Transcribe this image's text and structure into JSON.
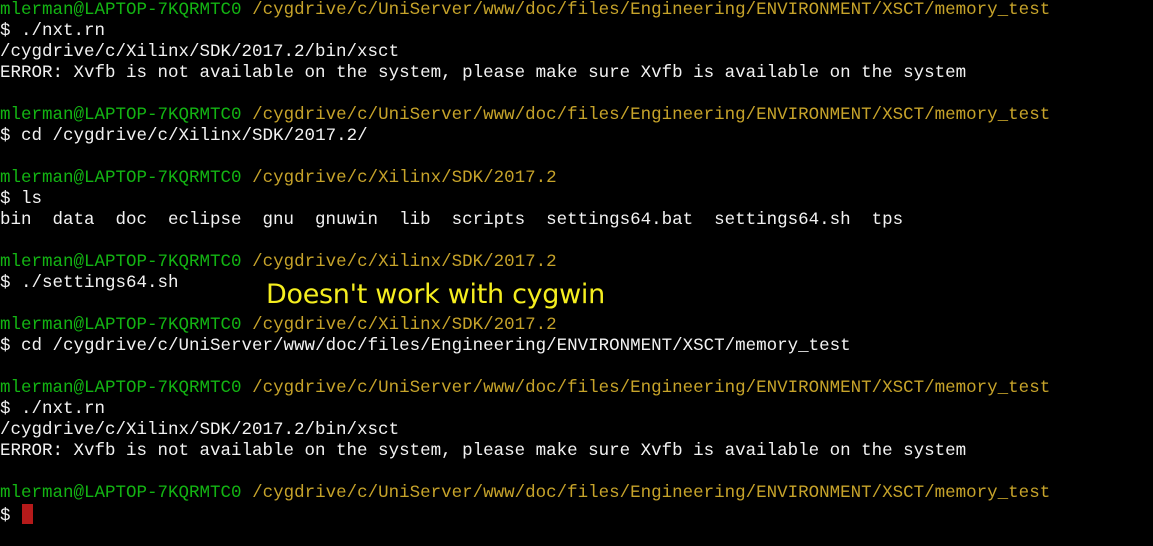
{
  "colors": {
    "background": "#000000",
    "user_host": "#13b413",
    "path": "#c6a32a",
    "text": "#f2f2f2",
    "annotation": "#f5ee1f",
    "cursor": "#b51a1a"
  },
  "prompt": {
    "user_host": "mlerman@LAPTOP-7KQRMTC0",
    "symbol": "$ "
  },
  "blocks": [
    {
      "path": "/cygdrive/c/UniServer/www/doc/files/Engineering/ENVIRONMENT/XSCT/memory_test",
      "command": "./nxt.rn",
      "output": [
        "/cygdrive/c/Xilinx/SDK/2017.2/bin/xsct",
        "ERROR: Xvfb is not available on the system, please make sure Xvfb is available on the system"
      ]
    },
    {
      "path": "/cygdrive/c/UniServer/www/doc/files/Engineering/ENVIRONMENT/XSCT/memory_test",
      "command": "cd /cygdrive/c/Xilinx/SDK/2017.2/",
      "output": []
    },
    {
      "path": "/cygdrive/c/Xilinx/SDK/2017.2",
      "command": "ls",
      "output": [
        "bin  data  doc  eclipse  gnu  gnuwin  lib  scripts  settings64.bat  settings64.sh  tps"
      ]
    },
    {
      "path": "/cygdrive/c/Xilinx/SDK/2017.2",
      "command": "./settings64.sh",
      "output": []
    },
    {
      "path": "/cygdrive/c/Xilinx/SDK/2017.2",
      "command": "cd /cygdrive/c/UniServer/www/doc/files/Engineering/ENVIRONMENT/XSCT/memory_test",
      "output": []
    },
    {
      "path": "/cygdrive/c/UniServer/www/doc/files/Engineering/ENVIRONMENT/XSCT/memory_test",
      "command": "./nxt.rn",
      "output": [
        "/cygdrive/c/Xilinx/SDK/2017.2/bin/xsct",
        "ERROR: Xvfb is not available on the system, please make sure Xvfb is available on the system"
      ]
    },
    {
      "path": "/cygdrive/c/UniServer/www/doc/files/Engineering/ENVIRONMENT/XSCT/memory_test",
      "command": "",
      "output": [],
      "cursor": true
    }
  ],
  "annotation": {
    "text": "Doesn't work with cygwin"
  }
}
